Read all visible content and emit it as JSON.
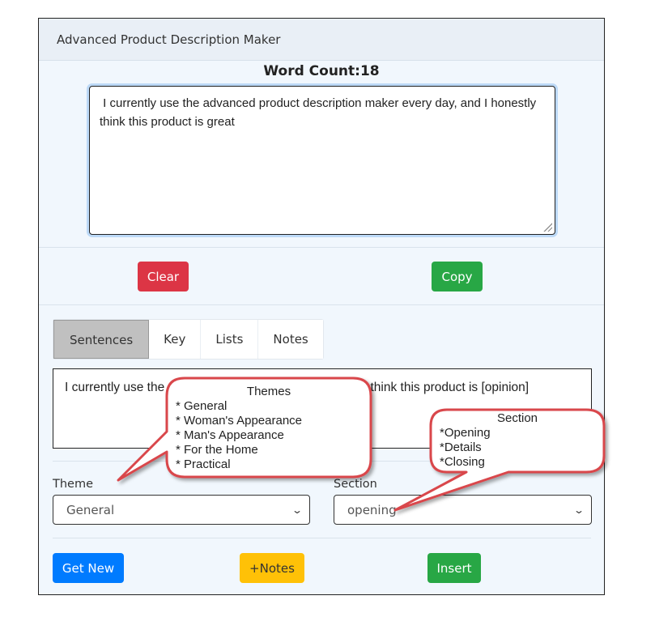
{
  "card": {
    "title": "Advanced Product Description Maker",
    "word_count_label": "Word Count:18"
  },
  "editor": {
    "value": " I currently use the advanced product description maker every day, and I honestly think this product is great"
  },
  "actions": {
    "clear_label": "Clear",
    "copy_label": "Copy"
  },
  "tabs": [
    {
      "label": "Sentences",
      "active": true
    },
    {
      "label": "Key",
      "active": false
    },
    {
      "label": "Lists",
      "active": false
    },
    {
      "label": "Notes",
      "active": false
    }
  ],
  "sentence": {
    "text": "I currently use the [product] every day, and I honestly think this product is [opinion]",
    "visible_left": "I currently use the",
    "visible_right": "ly think this product is [opinion]"
  },
  "theme": {
    "label": "Theme",
    "selected": "General"
  },
  "section": {
    "label": "Section",
    "selected": "opening"
  },
  "bottom_actions": {
    "get_new_label": "Get New",
    "notes_label": "+Notes",
    "insert_label": "Insert"
  },
  "annotations": {
    "themes": {
      "title": "Themes",
      "items": [
        "* General",
        "* Woman's Appearance",
        "* Man's Appearance",
        "* For the Home",
        "* Practical"
      ]
    },
    "section": {
      "title": "Section",
      "items": [
        "*Opening",
        "*Details",
        "*Closing"
      ]
    }
  },
  "colors": {
    "danger": "#dc3545",
    "success": "#28a745",
    "primary": "#007bff",
    "warning": "#ffc107",
    "callout_border": "#d9464b"
  }
}
